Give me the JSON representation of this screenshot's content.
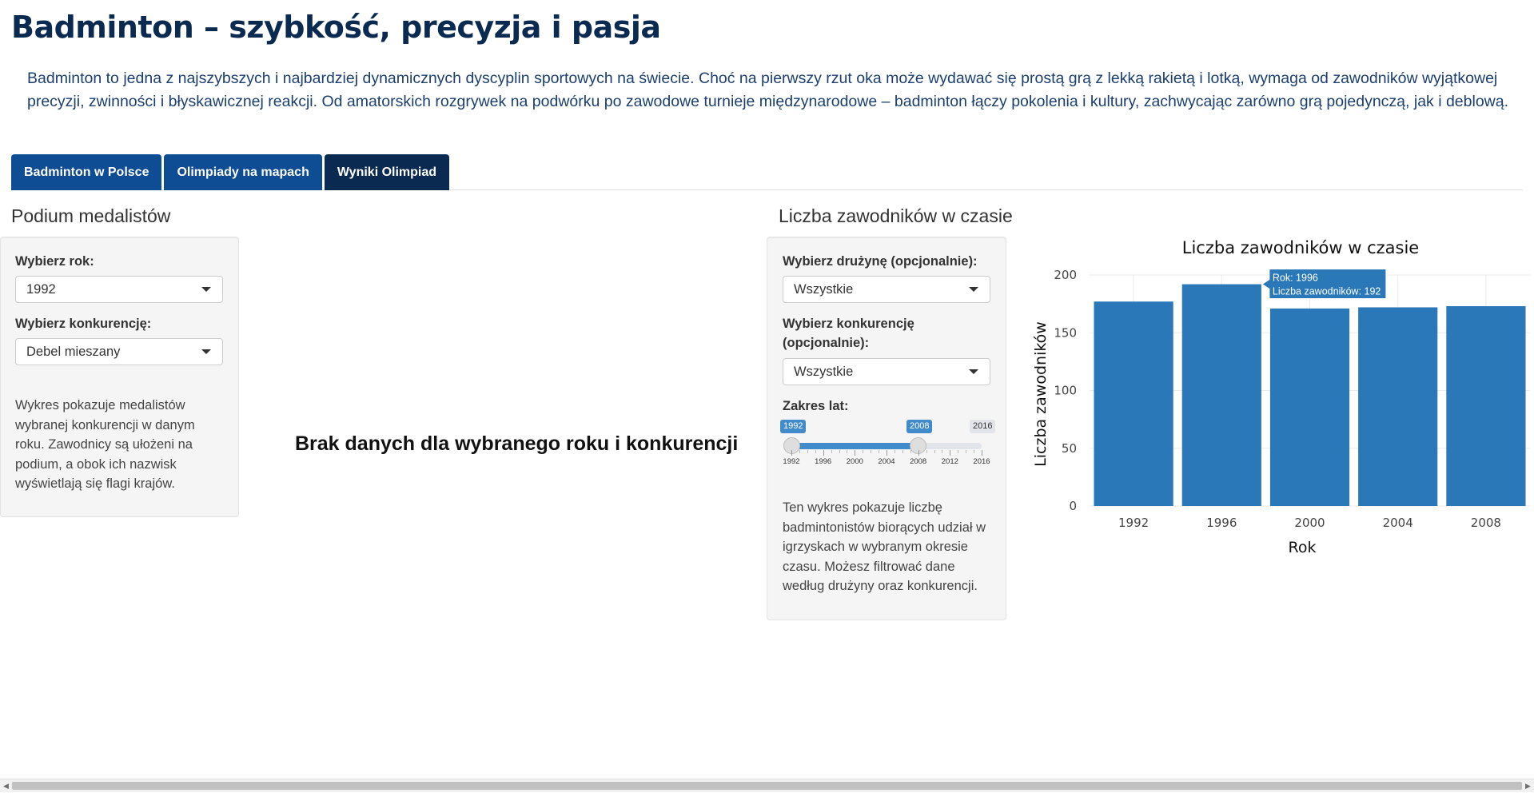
{
  "page": {
    "title": "Badminton – szybkość, precyzja i pasja",
    "intro": "Badminton to jedna z najszybszych i najbardziej dynamicznych dyscyplin sportowych na świecie. Choć na pierwszy rzut oka może wydawać się prostą grą z lekką rakietą i lotką, wymaga od zawodników wyjątkowej precyzji, zwinności i błyskawicznej reakcji. Od amatorskich rozgrywek na podwórku po zawodowe turnieje międzynarodowe – badminton łączy pokolenia i kultury, zachwycając zarówno grą pojedynczą, jak i deblową."
  },
  "tabs": [
    {
      "label": "Badminton w Polsce",
      "active": false
    },
    {
      "label": "Olimpiady na mapach",
      "active": false
    },
    {
      "label": "Wyniki Olimpiad",
      "active": true
    }
  ],
  "podium": {
    "section_title": "Podium medalistów",
    "year_label": "Wybierz rok:",
    "year_value": "1992",
    "event_label": "Wybierz konkurencję:",
    "event_value": "Debel mieszany",
    "help": "Wykres pokazuje medalistów wybranej konkurencji w danym roku. Zawodnicy są ułożeni na podium, a obok ich nazwisk wyświetlają się flagi krajów.",
    "no_data": "Brak danych dla wybranego roku i konkurencji"
  },
  "participants": {
    "section_title": "Liczba zawodników w czasie",
    "team_label": "Wybierz drużynę (opcjonalnie):",
    "team_value": "Wszystkie",
    "event_label_line1": "Wybierz konkurencję",
    "event_label_line2": "(opcjonalnie):",
    "event_value": "Wszystkie",
    "range_label": "Zakres lat:",
    "range_from": "1992",
    "range_to": "2008",
    "range_min": "1992",
    "range_max": "2016",
    "range_ticks": [
      "1992",
      "1996",
      "2000",
      "2004",
      "2008",
      "2012",
      "2016"
    ],
    "help": "Ten wykres pokazuje liczbę badmintonistów biorących udział w igrzyskach w wybranym okresie czasu. Możesz filtrować dane według drużyny oraz konkurencji."
  },
  "chart_data": {
    "type": "bar",
    "title": "Liczba zawodników w czasie",
    "xlabel": "Rok",
    "ylabel": "Liczba zawodników",
    "categories": [
      "1992",
      "1996",
      "2000",
      "2004",
      "2008"
    ],
    "values": [
      177,
      192,
      171,
      172,
      173
    ],
    "ylim": [
      0,
      200
    ],
    "yticks": [
      0,
      50,
      100,
      150,
      200
    ],
    "grid": true,
    "bar_color": "#2a78b8",
    "tooltip": {
      "category": "1996",
      "line1": "Rok: 1996",
      "line2": "Liczba zawodników: 192"
    }
  },
  "colors": {
    "title": "#0b2a52",
    "tab": "#0e4c93",
    "tab_active": "#0b2a52",
    "slider": "#428bca"
  }
}
